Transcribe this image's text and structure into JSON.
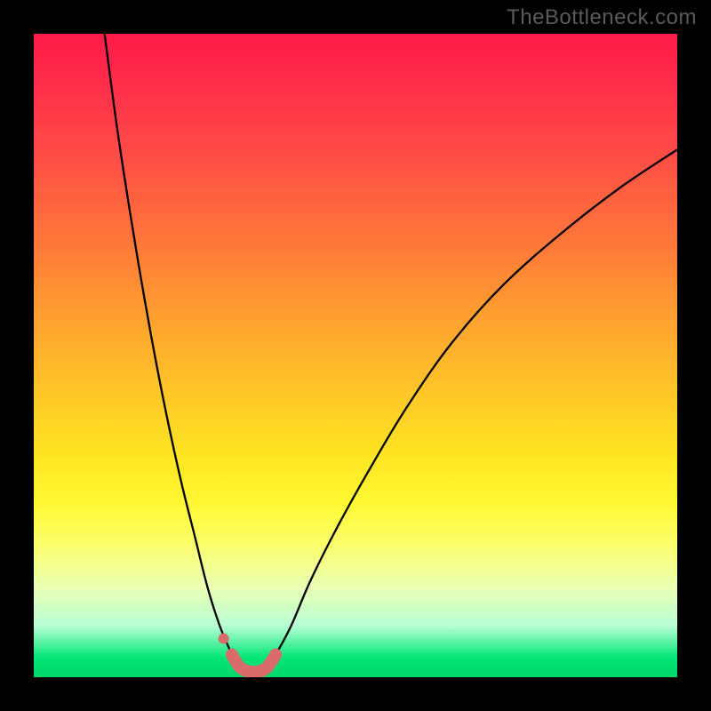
{
  "attribution": "TheBottleneck.com",
  "chart_data": {
    "type": "line",
    "title": "",
    "xlabel": "",
    "ylabel": "",
    "xlim": [
      0,
      100
    ],
    "ylim": [
      0,
      100
    ],
    "grid": false,
    "legend": false,
    "series": [
      {
        "name": "bottleneck-curve-left",
        "x": [
          11,
          13,
          15,
          17,
          19,
          21,
          23,
          25,
          27,
          28.9,
          30.8
        ],
        "y": [
          100,
          85,
          72,
          60,
          49,
          39,
          30,
          22,
          14,
          8,
          3.5
        ]
      },
      {
        "name": "bottleneck-curve-right",
        "x": [
          37.6,
          40,
          43,
          47,
          52,
          58,
          65,
          73,
          82,
          91,
          100
        ],
        "y": [
          3.5,
          8,
          15,
          23,
          32,
          42,
          52,
          61,
          69,
          76,
          82
        ]
      },
      {
        "name": "bottleneck-basin-highlight",
        "x": [
          30.8,
          32,
          33.4,
          35,
          36.3,
          37.6
        ],
        "y": [
          3.5,
          1.6,
          0.9,
          0.9,
          1.6,
          3.5
        ]
      },
      {
        "name": "marker-dot",
        "x": [
          29.5
        ],
        "y": [
          6.0
        ]
      }
    ],
    "colors": {
      "curve": "#000000",
      "highlight": "#d96b6b"
    }
  }
}
